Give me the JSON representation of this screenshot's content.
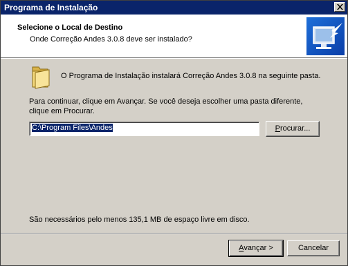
{
  "window": {
    "title": "Programa de Instalação"
  },
  "header": {
    "title": "Selecione o Local de Destino",
    "subtitle": "Onde Correção Andes 3.0.8 deve ser instalado?"
  },
  "body": {
    "info": "O Programa de Instalação instalará Correção Andes 3.0.8 na seguinte pasta.",
    "continue_line1": "Para continuar, clique em Avançar. Se você deseja escolher uma pasta diferente,",
    "continue_line2": "clique em Procurar.",
    "path_value": "C:\\Program Files\\Andes",
    "disk_space": "São necessários pelo menos 135,1 MB de espaço livre em disco."
  },
  "buttons": {
    "browse_mnemonic": "P",
    "browse_rest": "rocurar...",
    "next_mnemonic": "A",
    "next_rest": "vançar >",
    "cancel": "Cancelar"
  },
  "icons": {
    "close": "close-icon",
    "wizard": "computer-install-icon",
    "folder": "folder-icon"
  },
  "colors": {
    "titlebar": "#0a246a",
    "dialog_bg": "#d4d0c8",
    "selection": "#0a246a"
  }
}
